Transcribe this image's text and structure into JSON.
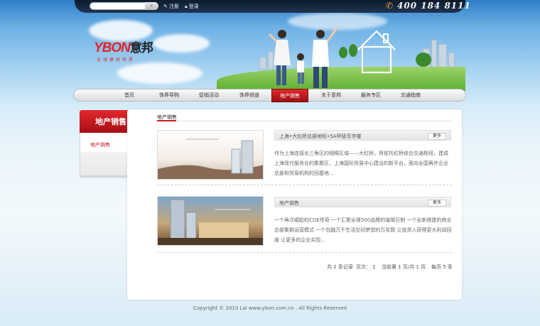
{
  "header": {
    "register_label": "注册",
    "login_label": "登录",
    "phone": "400 184 8111",
    "search_button": "⌕"
  },
  "logo": {
    "latin": "YBON",
    "cn": "意邦",
    "tagline": "全球建材饰界"
  },
  "nav": {
    "items": [
      "首页",
      "饰界导购",
      "促销活动",
      "饰界频道",
      "地产销售",
      "关于意邦",
      "服务专区",
      "交通指南"
    ],
    "active_index": 4
  },
  "sidebar": {
    "title": "地产销售",
    "items": [
      {
        "label": "地产销售",
        "arrow": "◄"
      }
    ]
  },
  "main": {
    "breadcrumb": "地产销售",
    "items": [
      {
        "title": "上海•大虹桥总部地标•5A甲级写字楼",
        "more": "更多",
        "desc": "作为上海连接长三角区的咽喉区域——大虹桥，将依托虹桥综合交通枢纽，建成上海现代服务业的集聚区，上海国际贸易中心建设的新平台，面向全国再外企业总部和贸易机构的回基地..."
      },
      {
        "title": "地产销售",
        "more": "更多",
        "desc": "一个再次崛起的CDE传奇 一个汇聚全球500品牌的璀璨巨制 一个全新搭建的商业总部集群运营模式 一个包融万千生活空间梦想的万花筒 让投资人获得更大利润回报 让更多的企业实现..."
      }
    ],
    "pager": {
      "total": "共 2 条记录",
      "pages": "页次： 1",
      "current": "当前第 1 页/共 1 页",
      "per_page": "每页 5 条"
    }
  },
  "footer": {
    "copyright": "Copyright © 2010 Lai www.ybon.com.cn . All Rights Reserved"
  }
}
